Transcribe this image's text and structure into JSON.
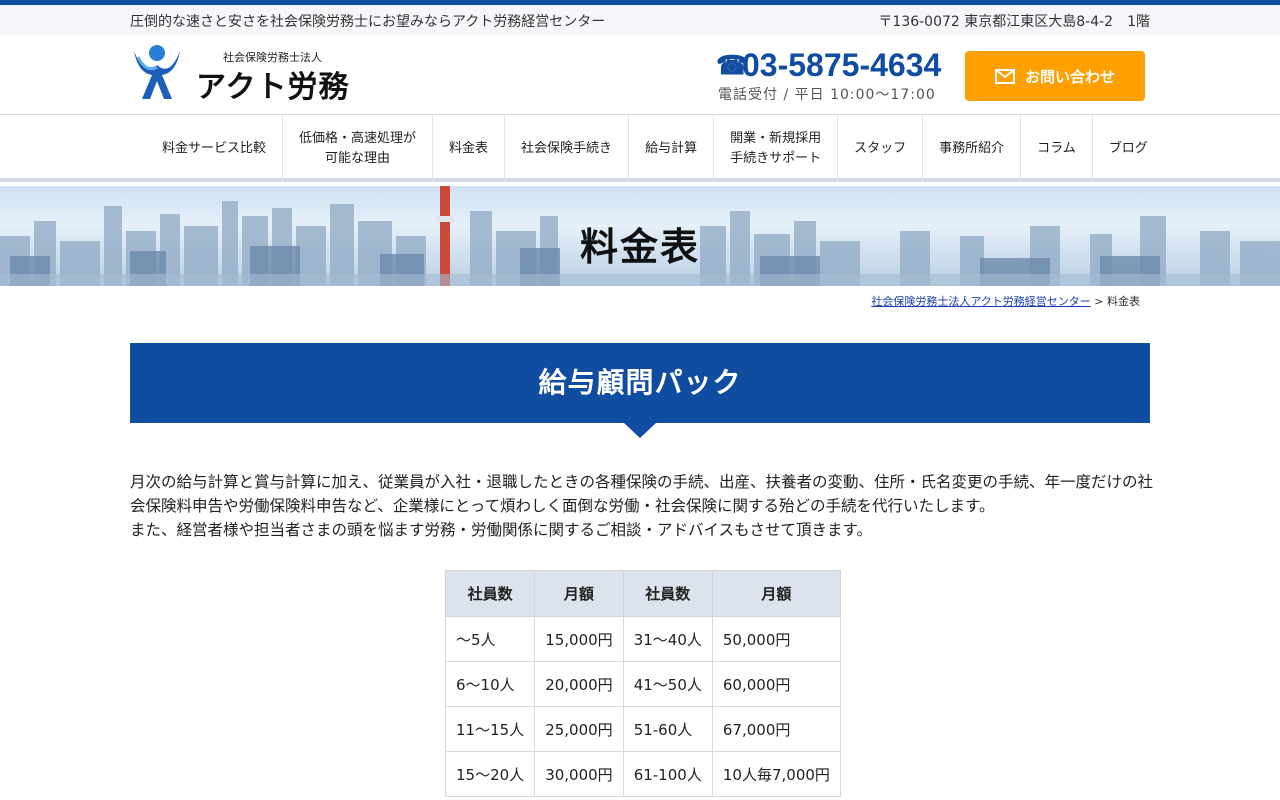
{
  "topbar": {
    "tagline": "圧倒的な速さと安さを社会保険労務士にお望みならアクト労務経営センター",
    "address": "〒136-0072 東京都江東区大島8-4-2　1階"
  },
  "logo": {
    "sub": "社会保険労務士法人",
    "main": "アクト労務"
  },
  "contact": {
    "phone": "03-5875-4634",
    "hours": "電話受付 / 平日 10:00〜17:00",
    "button_label": "お問い合わせ"
  },
  "nav": {
    "items": [
      {
        "label": "料金サービス比較"
      },
      {
        "label": "低価格・高速処理が\n可能な理由"
      },
      {
        "label": "料金表"
      },
      {
        "label": "社会保険手続き"
      },
      {
        "label": "給与計算"
      },
      {
        "label": "開業・新規採用\n手続きサポート"
      },
      {
        "label": "スタッフ"
      },
      {
        "label": "事務所紹介"
      },
      {
        "label": "コラム"
      },
      {
        "label": "ブログ"
      }
    ]
  },
  "hero": {
    "title": "料金表"
  },
  "breadcrumb": {
    "home": "社会保険労務士法人アクト労務経営センター",
    "separator": " > ",
    "current": "料金表"
  },
  "section": {
    "title": "給与顧問パック",
    "description_1": "月次の給与計算と賞与計算に加え、従業員が入社・退職したときの各種保険の手続、出産、扶養者の変動、住所・氏名変更の手続、年一度だけの社会保険料申告や労働保険料申告など、企業様にとって煩わしく面倒な労働・社会保険に関する殆どの手続を代行いたします。",
    "description_2": "また、経営者様や担当者さまの頭を悩ます労務・労働関係に関するご相談・アドバイスもさせて頂きます。"
  },
  "price_table": {
    "headers": [
      "社員数",
      "月額",
      "社員数",
      "月額"
    ],
    "rows": [
      [
        "〜5人",
        "15,000円",
        "31〜40人",
        "50,000円"
      ],
      [
        "6〜10人",
        "20,000円",
        "41〜50人",
        "60,000円"
      ],
      [
        "11〜15人",
        "25,000円",
        "51-60人",
        "67,000円"
      ],
      [
        "15〜20人",
        "30,000円",
        "61-100人",
        "10人毎7,000円"
      ]
    ]
  },
  "colors": {
    "brand_blue": "#104da0",
    "accent_orange": "#ff9f00",
    "table_header": "#dde3ec"
  }
}
